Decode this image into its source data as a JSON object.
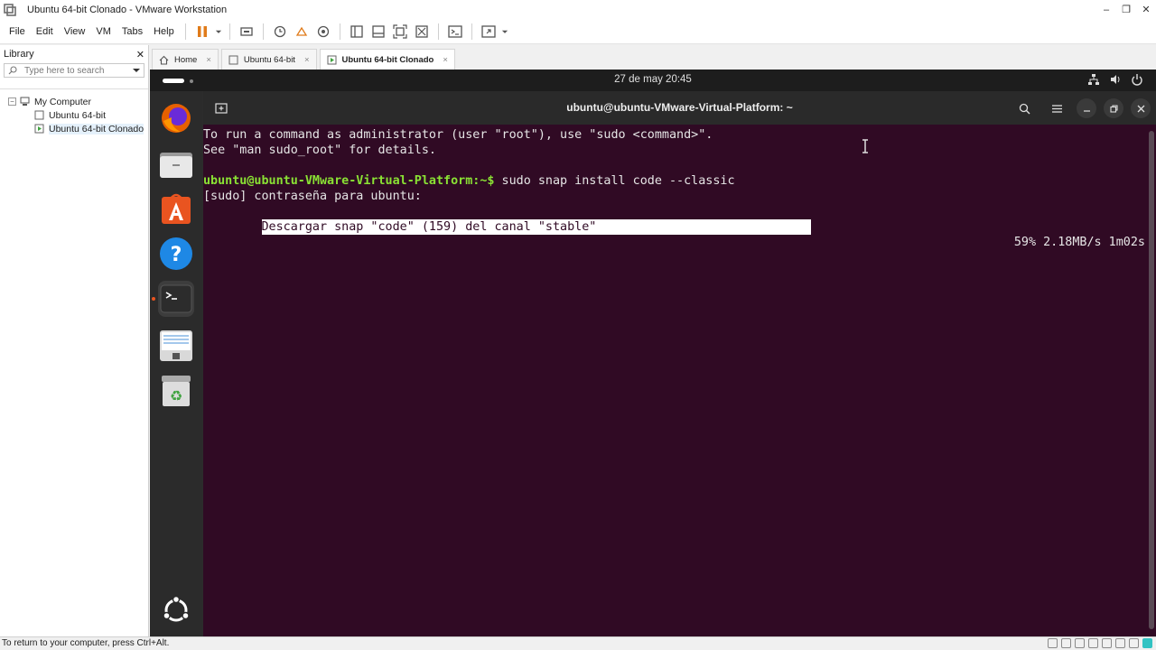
{
  "window": {
    "title": "Ubuntu 64-bit Clonado - VMware Workstation",
    "minimize": "–",
    "restore": "❐",
    "close": "✕"
  },
  "menu": [
    "File",
    "Edit",
    "View",
    "VM",
    "Tabs",
    "Help"
  ],
  "library": {
    "title": "Library",
    "close": "✕",
    "search_placeholder": "Type here to search",
    "root": "My Computer",
    "items": [
      "Ubuntu 64-bit",
      "Ubuntu 64-bit Clonado"
    ]
  },
  "tabs": [
    {
      "label": "Home"
    },
    {
      "label": "Ubuntu 64-bit"
    },
    {
      "label": "Ubuntu 64-bit Clonado",
      "active": true
    }
  ],
  "tab_close": "×",
  "ubuntu": {
    "clock": "27 de may  20:45",
    "terminal_title": "ubuntu@ubuntu-VMware-Virtual-Platform: ~",
    "lines": [
      "To run a command as administrator (user \"root\"), use \"sudo <command>\".",
      "See \"man sudo_root\" for details.",
      ""
    ],
    "prompt": "ubuntu@ubuntu-VMware-Virtual-Platform:~$",
    "command": " sudo snap install code --classic",
    "sudo_line": "[sudo] contraseña para ubuntu:",
    "download_line": "Descargar snap \"code\" (159) del canal \"stable\"",
    "progress": "59% 2.18MB/s 1m02s",
    "progress_percent": 59
  },
  "statusbar": {
    "text": "To return to your computer, press Ctrl+Alt."
  },
  "colors": {
    "terminal_bg": "#300a24",
    "prompt_green": "#8ae234",
    "ubuntu_orange": "#e95420",
    "vmware_pause": "#e07b1a"
  }
}
